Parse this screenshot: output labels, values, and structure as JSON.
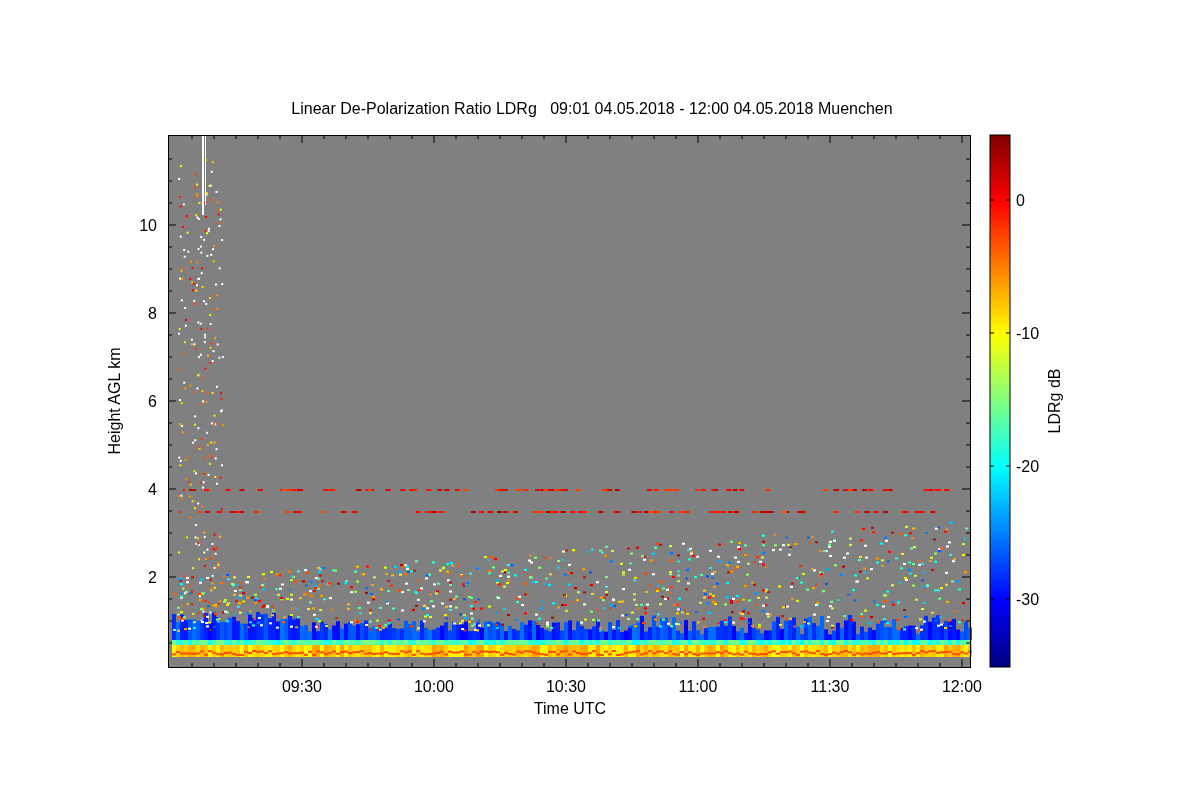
{
  "chart": {
    "title": "Linear De-Polarization Ratio LDRg   09:01 04.05.2018 - 12:00 04.05.2018 Muenchen",
    "ylabel": "Height AGL km",
    "xlabel": "Time UTC",
    "yticks": [
      "10",
      "8",
      "6",
      "4",
      "2"
    ],
    "xticks": [
      "09:30",
      "10:00",
      "10:30",
      "11:00",
      "11:30",
      "12:00"
    ]
  },
  "colorbar": {
    "label": "LDRg dB",
    "ticks": [
      "0",
      "-10",
      "-20",
      "-30"
    ]
  }
}
